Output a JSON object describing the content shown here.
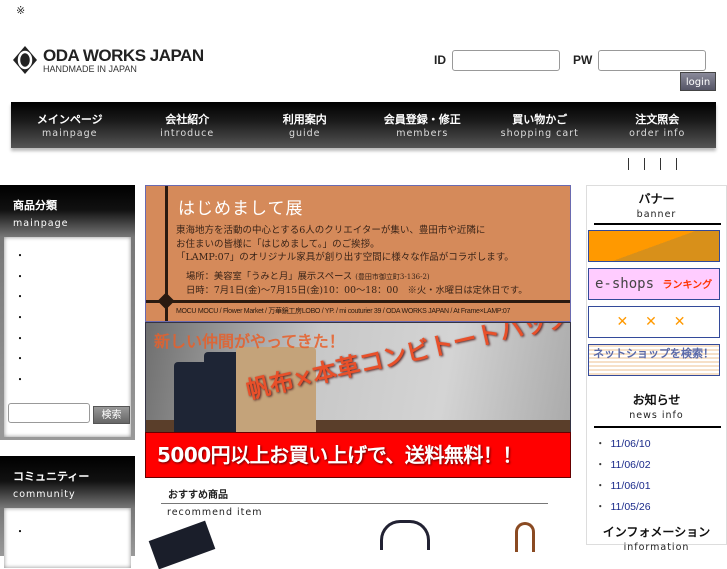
{
  "top_mark": "※",
  "logo": {
    "title": "ODA WORKS JAPAN",
    "subtitle": "HANDMADE IN JAPAN"
  },
  "login": {
    "id_label": "ID",
    "pw_label": "PW",
    "id_value": "",
    "pw_value": "",
    "button": "login"
  },
  "nav": [
    {
      "jp": "メインページ",
      "en": "mainpage"
    },
    {
      "jp": "会社紹介",
      "en": "introduce"
    },
    {
      "jp": "利用案内",
      "en": "guide"
    },
    {
      "jp": "会員登録・修正",
      "en": "members"
    },
    {
      "jp": "買い物かご",
      "en": "shopping cart"
    },
    {
      "jp": "注文照会",
      "en": "order info"
    }
  ],
  "left": {
    "category": {
      "jp": "商品分類",
      "en": "mainpage",
      "items": [
        "・",
        "・",
        "・",
        "・",
        "・",
        "・",
        "・"
      ],
      "search_value": "",
      "search_button": "検索"
    },
    "community": {
      "jp": "コミュニティー",
      "en": "community",
      "items": [
        "・"
      ]
    }
  },
  "banners": {
    "event": {
      "title": "はじめまして展",
      "line1": "東海地方を活動の中心とする6人のクリエイターが集い、豊田市や近隣に",
      "line2": "お住まいの皆様に「はじめまして。」のご挨拶。",
      "line3": "「LAMP:07」のオリジナル家具が創り出す空間に様々な作品がコラボします。",
      "place": "場所：美容室「うみと月」展示スペース",
      "address": "(豊田市御立町3-136-2)",
      "date": "日時：7月1日(金)～7月15日(金)10：00～18：00　※火・水曜日は定休日です。",
      "participants": "MOCU MOCU / Flower Market / 万華鏡工房LOBO / YP. / mi couturier 39 / ODA WORKS JAPAN / At Frame×LAMP:07"
    },
    "bag": {
      "headline": "新しい仲間がやってきた！",
      "product": "帆布×本革コンビトートバッグ"
    },
    "shipping": "5000円以上お買い上げで、送料無料！！"
  },
  "recommend": {
    "jp": "おすすめ商品",
    "en": "recommend item"
  },
  "right": {
    "banner": {
      "jp": "バナー",
      "en": "banner",
      "eshops": "e-shops",
      "ranking": "ランキング",
      "netshop": "ネットショップを検索！"
    },
    "news": {
      "jp": "お知らせ",
      "en": "news info",
      "items": [
        "11/06/10",
        "11/06/02",
        "11/06/01",
        "11/05/26"
      ]
    },
    "info": {
      "jp": "インフォメーション",
      "en": "information"
    }
  },
  "colors": {
    "accent_orange": "#d58a5a",
    "sale_red": "#ff0000",
    "news_link": "#1a2a8a"
  }
}
